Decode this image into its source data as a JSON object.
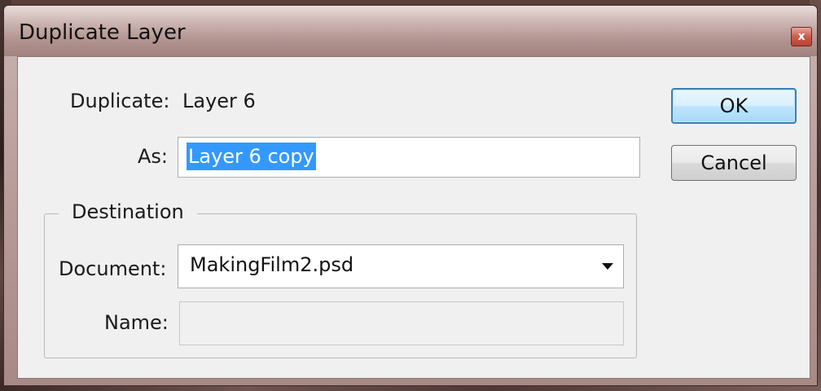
{
  "window": {
    "title": "Duplicate Layer",
    "close_glyph": "x"
  },
  "duplicate": {
    "label": "Duplicate:",
    "value": "Layer 6"
  },
  "as": {
    "label": "As:",
    "value": "Layer 6 copy"
  },
  "destination": {
    "legend": "Destination",
    "document_label": "Document:",
    "document_value": "MakingFilm2.psd",
    "name_label": "Name:",
    "name_value": ""
  },
  "buttons": {
    "ok": "OK",
    "cancel": "Cancel"
  },
  "icons": {
    "close": "close-icon",
    "dropdown": "chevron-down-icon"
  },
  "colors": {
    "selection": "#3399ff",
    "default_button_border": "#3c7fb1",
    "close_button": "#cc5c4c"
  }
}
